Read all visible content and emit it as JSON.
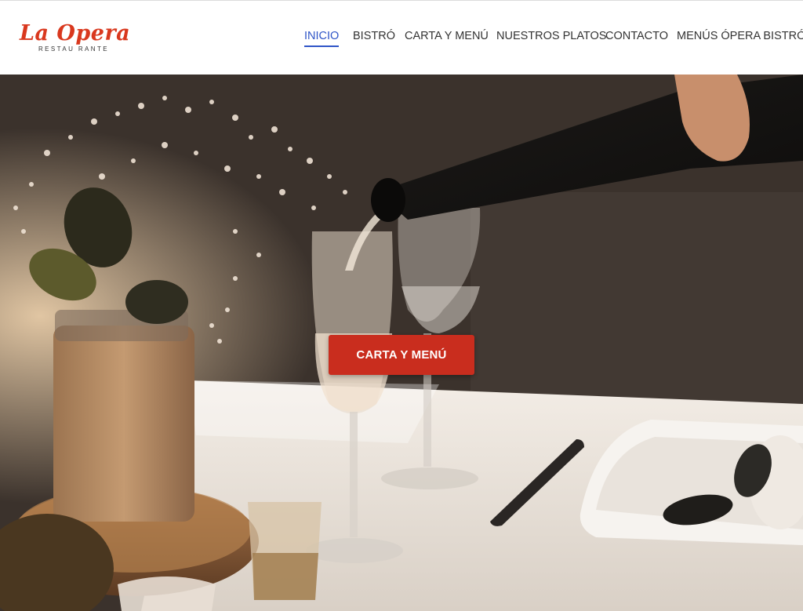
{
  "brand": {
    "name": "La Opera",
    "tagline": "RESTAU RANTE",
    "color": "#d9381e"
  },
  "nav": {
    "items": [
      {
        "label": "INICIO",
        "active": true
      },
      {
        "label": "BISTRÓ",
        "active": false
      },
      {
        "label": "CARTA Y MENÚ",
        "active": false
      },
      {
        "label": "NUESTROS PLATOS",
        "active": false
      },
      {
        "label": "CONTACTO",
        "active": false
      },
      {
        "label": "MENÚS ÓPERA BISTRÓ",
        "active": false
      }
    ],
    "active_color": "#2f55c7"
  },
  "hero": {
    "cta_label": "CARTA Y MENÚ",
    "cta_color": "#c92d1e",
    "image_icon": "restaurant-table-photo"
  }
}
